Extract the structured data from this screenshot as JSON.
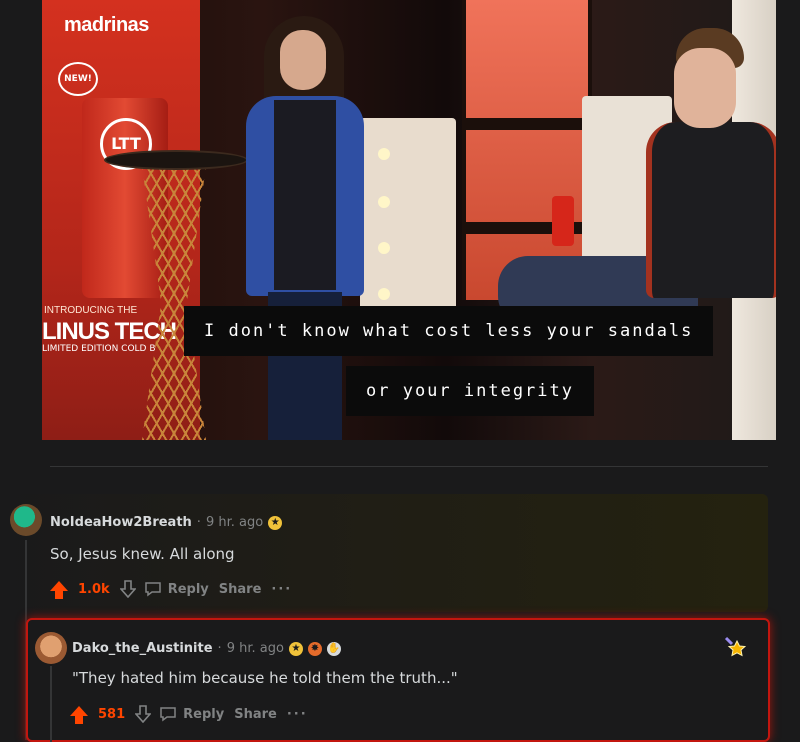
{
  "image": {
    "banner_brand": "madrinas",
    "banner_new": "NEW!",
    "banner_ltt": "LTT",
    "banner_intro": "INTRODUCING THE",
    "banner_title": "LINUS TECH",
    "banner_limited": "LIMITED EDITION COLD B",
    "caption_line1": "I don't know what cost less your sandals",
    "caption_line2": "or your integrity"
  },
  "comments": [
    {
      "username": "NoIdeaHow2Breath",
      "time": "9 hr. ago",
      "body": "So, Jesus knew. All along",
      "score": "1.0k",
      "reply_label": "Reply",
      "share_label": "Share",
      "more_label": "···",
      "awards": [
        "gold-award-icon"
      ]
    },
    {
      "username": "Dako_the_Austinite",
      "time": "9 hr. ago",
      "body": "\"They hated him because he told them the truth...\"",
      "score": "581",
      "reply_label": "Reply",
      "share_label": "Share",
      "more_label": "···",
      "awards": [
        "gold-award-icon",
        "explosion-award-icon",
        "hands-award-icon"
      ]
    }
  ],
  "colors": {
    "background": "#1a1a1b",
    "upvote": "#ff4500",
    "highlight_border": "#c3160f",
    "muted_text": "#818384"
  }
}
